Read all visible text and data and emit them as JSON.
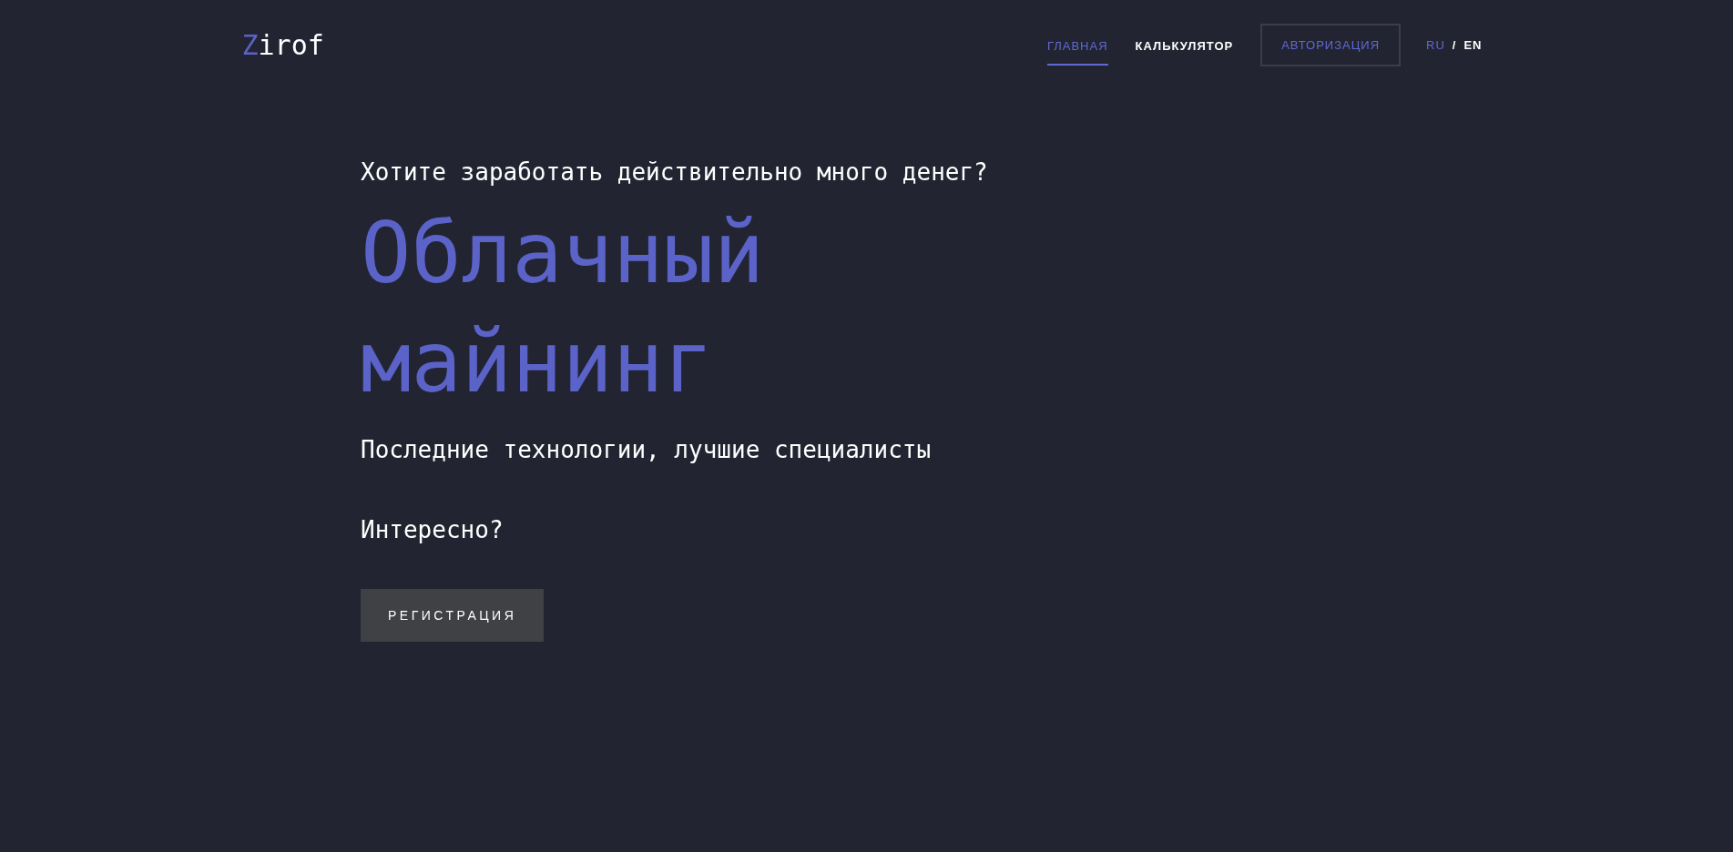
{
  "logo": {
    "accent": "Z",
    "rest": "irof"
  },
  "nav": [
    {
      "label": "ГЛАВНАЯ",
      "selected": true
    },
    {
      "label": "КАЛЬКУЛЯТОР",
      "selected": false
    }
  ],
  "auth_button": "АВТОРИЗАЦИЯ",
  "languages": [
    {
      "label": "RU",
      "selected": true
    },
    {
      "label": "EN",
      "selected": false
    }
  ],
  "language_separator": "/",
  "hero": {
    "kicker": "Хотите заработать действительно много денег?",
    "title_lines": [
      "Облачный",
      "майнинг"
    ],
    "subtitle": "Последние технологии, лучшие специалисты",
    "question": "Интересно?",
    "cta": "РЕГИСТРАЦИЯ"
  }
}
